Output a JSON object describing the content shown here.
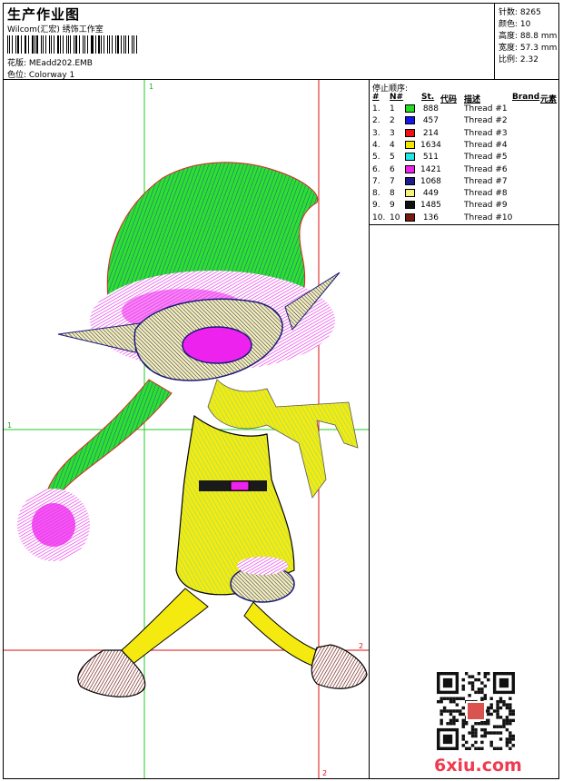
{
  "header": {
    "title": "生产作业图",
    "company": "Wilcom(汇宏) 绣饰工作室",
    "design": "花版: MEadd202.EMB",
    "colorway": "色位: Colorway 1"
  },
  "stats": [
    {
      "label": "针数:",
      "value": "8265"
    },
    {
      "label": "颜色:",
      "value": "10"
    },
    {
      "label": "高度:",
      "value": "88.8 mm"
    },
    {
      "label": "宽度:",
      "value": "57.3 mm"
    },
    {
      "label": "比例:",
      "value": "2.32"
    }
  ],
  "stop_sequence": {
    "title": "停止顺序:",
    "columns": [
      "#",
      "N#",
      "St.",
      "代码",
      "描述",
      "Brand",
      "元素"
    ],
    "rows": [
      {
        "n": "1.",
        "nn": "1",
        "color": "#22dd22",
        "st": "888",
        "desc": "Thread #1"
      },
      {
        "n": "2.",
        "nn": "2",
        "color": "#1515ee",
        "st": "457",
        "desc": "Thread #2"
      },
      {
        "n": "3.",
        "nn": "3",
        "color": "#ee1111",
        "st": "214",
        "desc": "Thread #3"
      },
      {
        "n": "4.",
        "nn": "4",
        "color": "#f5e600",
        "st": "1634",
        "desc": "Thread #4"
      },
      {
        "n": "5.",
        "nn": "5",
        "color": "#20e8e8",
        "st": "511",
        "desc": "Thread #5"
      },
      {
        "n": "6.",
        "nn": "6",
        "color": "#ee22ee",
        "st": "1421",
        "desc": "Thread #6"
      },
      {
        "n": "7.",
        "nn": "7",
        "color": "#1b1b8a",
        "st": "1068",
        "desc": "Thread #7"
      },
      {
        "n": "8.",
        "nn": "8",
        "color": "#f5f07a",
        "st": "449",
        "desc": "Thread #8"
      },
      {
        "n": "9.",
        "nn": "9",
        "color": "#111111",
        "st": "1485",
        "desc": "Thread #9"
      },
      {
        "n": "10.",
        "nn": "10",
        "color": "#7a1a10",
        "st": "136",
        "desc": "Thread #10"
      }
    ]
  },
  "guides": {
    "v1": "1",
    "h1": "1",
    "v2": "2",
    "h2": "2"
  },
  "watermark": "6xiu.com"
}
